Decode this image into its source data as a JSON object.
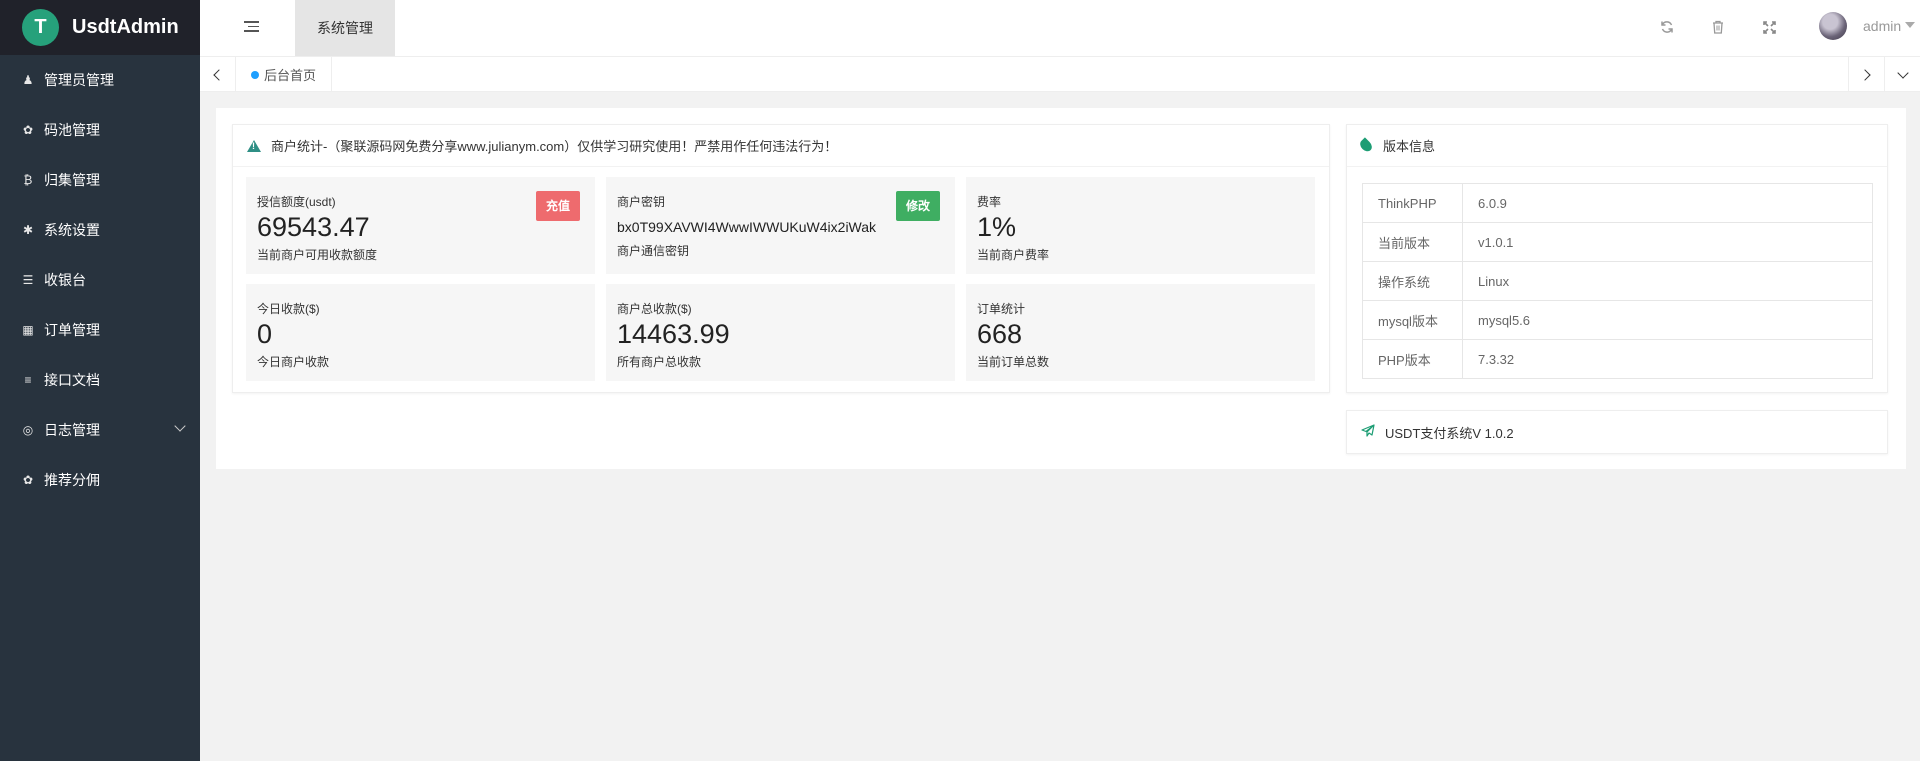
{
  "app": {
    "logo_glyph": "T",
    "title": "UsdtAdmin"
  },
  "sidebar": {
    "items": [
      {
        "label": "管理员管理",
        "icon": "user-icon",
        "glyph": "♟"
      },
      {
        "label": "码池管理",
        "icon": "android-icon",
        "glyph": "✿"
      },
      {
        "label": "归集管理",
        "icon": "bitcoin-icon",
        "glyph": "₿"
      },
      {
        "label": "系统设置",
        "icon": "asterisk-icon",
        "glyph": "✱"
      },
      {
        "label": "收银台",
        "icon": "list-icon",
        "glyph": "☰"
      },
      {
        "label": "订单管理",
        "icon": "calculator-icon",
        "glyph": "▦"
      },
      {
        "label": "接口文档",
        "icon": "align-left-icon",
        "glyph": "≡"
      },
      {
        "label": "日志管理",
        "icon": "life-ring-icon",
        "glyph": "◎"
      },
      {
        "label": "推荐分佣",
        "icon": "android-icon",
        "glyph": "✿"
      }
    ]
  },
  "header": {
    "active_tab": "系统管理",
    "username": "admin",
    "icons": [
      "refresh-icon",
      "trash-icon",
      "fullscreen-icon"
    ]
  },
  "tabs": {
    "home": "后台首页"
  },
  "merchant": {
    "header": "商户统计-（聚联源码网免费分享www.julianym.com）仅供学习研究使用！严禁用作任何违法行为！",
    "stats": [
      {
        "title": "授信额度(usdt)",
        "value": "69543.47",
        "desc": "当前商户可用收款额度",
        "button": "充值"
      },
      {
        "title": "商户密钥",
        "value": "bx0T99XAVWI4WwwIWWUKuW4ix2iWak",
        "desc": "商户通信密钥",
        "button": "修改"
      },
      {
        "title": "费率",
        "value": "1%",
        "desc": "当前商户费率"
      },
      {
        "title": "今日收款($)",
        "value": "0",
        "desc": "今日商户收款"
      },
      {
        "title": "商户总收款($)",
        "value": "14463.99",
        "desc": "所有商户总收款"
      },
      {
        "title": "订单统计",
        "value": "668",
        "desc": "当前订单总数"
      }
    ]
  },
  "version": {
    "header": "版本信息",
    "rows": [
      {
        "key": "ThinkPHP",
        "value": "6.0.9"
      },
      {
        "key": "当前版本",
        "value": "v1.0.1"
      },
      {
        "key": "操作系统",
        "value": "Linux"
      },
      {
        "key": "mysql版本",
        "value": "mysql5.6"
      },
      {
        "key": "PHP版本",
        "value": "7.3.32"
      }
    ]
  },
  "footer_card": {
    "label": "USDT支付系统V 1.0.2"
  },
  "colors": {
    "sidebar": "#28333e",
    "logo_bg": "#20222a",
    "accent": "#26a17b",
    "red": "#ee6b6e",
    "green": "#3fae62",
    "blue_dot": "#1e9fff"
  }
}
